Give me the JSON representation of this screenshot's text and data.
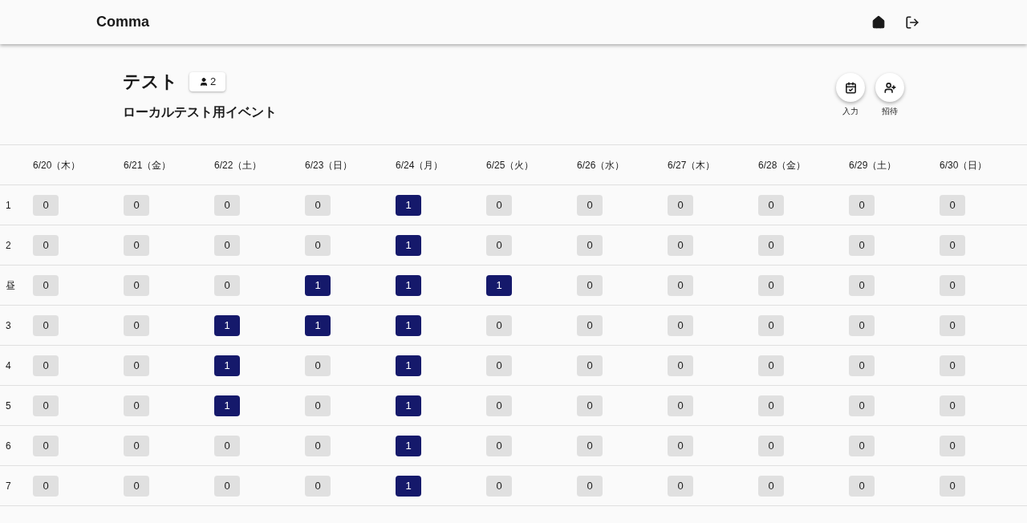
{
  "app_bar": {
    "title": "Comma"
  },
  "event": {
    "title": "テスト",
    "member_count": "2",
    "description": "ローカルテスト用イベント"
  },
  "actions": [
    {
      "kind": "input",
      "label": "入力"
    },
    {
      "kind": "invite",
      "label": "招待"
    }
  ],
  "table": {
    "columns": [
      "6/20（木）",
      "6/21（金）",
      "6/22（土）",
      "6/23（日）",
      "6/24（月）",
      "6/25（火）",
      "6/26（水）",
      "6/27（木）",
      "6/28（金）",
      "6/29（土）",
      "6/30（日）"
    ],
    "rows": [
      {
        "label": "1",
        "cells": [
          {
            "count": "0",
            "highlighted": false
          },
          {
            "count": "0",
            "highlighted": false
          },
          {
            "count": "0",
            "highlighted": false
          },
          {
            "count": "0",
            "highlighted": false
          },
          {
            "count": "1",
            "highlighted": true
          },
          {
            "count": "0",
            "highlighted": false
          },
          {
            "count": "0",
            "highlighted": false
          },
          {
            "count": "0",
            "highlighted": false
          },
          {
            "count": "0",
            "highlighted": false
          },
          {
            "count": "0",
            "highlighted": false
          },
          {
            "count": "0",
            "highlighted": false
          }
        ]
      },
      {
        "label": "2",
        "cells": [
          {
            "count": "0",
            "highlighted": false
          },
          {
            "count": "0",
            "highlighted": false
          },
          {
            "count": "0",
            "highlighted": false
          },
          {
            "count": "0",
            "highlighted": false
          },
          {
            "count": "1",
            "highlighted": true
          },
          {
            "count": "0",
            "highlighted": false
          },
          {
            "count": "0",
            "highlighted": false
          },
          {
            "count": "0",
            "highlighted": false
          },
          {
            "count": "0",
            "highlighted": false
          },
          {
            "count": "0",
            "highlighted": false
          },
          {
            "count": "0",
            "highlighted": false
          }
        ]
      },
      {
        "label": "昼",
        "cells": [
          {
            "count": "0",
            "highlighted": false
          },
          {
            "count": "0",
            "highlighted": false
          },
          {
            "count": "0",
            "highlighted": false
          },
          {
            "count": "1",
            "highlighted": true
          },
          {
            "count": "1",
            "highlighted": true
          },
          {
            "count": "1",
            "highlighted": true
          },
          {
            "count": "0",
            "highlighted": false
          },
          {
            "count": "0",
            "highlighted": false
          },
          {
            "count": "0",
            "highlighted": false
          },
          {
            "count": "0",
            "highlighted": false
          },
          {
            "count": "0",
            "highlighted": false
          }
        ]
      },
      {
        "label": "3",
        "cells": [
          {
            "count": "0",
            "highlighted": false
          },
          {
            "count": "0",
            "highlighted": false
          },
          {
            "count": "1",
            "highlighted": true
          },
          {
            "count": "1",
            "highlighted": true
          },
          {
            "count": "1",
            "highlighted": true
          },
          {
            "count": "0",
            "highlighted": false
          },
          {
            "count": "0",
            "highlighted": false
          },
          {
            "count": "0",
            "highlighted": false
          },
          {
            "count": "0",
            "highlighted": false
          },
          {
            "count": "0",
            "highlighted": false
          },
          {
            "count": "0",
            "highlighted": false
          }
        ]
      },
      {
        "label": "4",
        "cells": [
          {
            "count": "0",
            "highlighted": false
          },
          {
            "count": "0",
            "highlighted": false
          },
          {
            "count": "1",
            "highlighted": true
          },
          {
            "count": "0",
            "highlighted": false
          },
          {
            "count": "1",
            "highlighted": true
          },
          {
            "count": "0",
            "highlighted": false
          },
          {
            "count": "0",
            "highlighted": false
          },
          {
            "count": "0",
            "highlighted": false
          },
          {
            "count": "0",
            "highlighted": false
          },
          {
            "count": "0",
            "highlighted": false
          },
          {
            "count": "0",
            "highlighted": false
          }
        ]
      },
      {
        "label": "5",
        "cells": [
          {
            "count": "0",
            "highlighted": false
          },
          {
            "count": "0",
            "highlighted": false
          },
          {
            "count": "1",
            "highlighted": true
          },
          {
            "count": "0",
            "highlighted": false
          },
          {
            "count": "1",
            "highlighted": true
          },
          {
            "count": "0",
            "highlighted": false
          },
          {
            "count": "0",
            "highlighted": false
          },
          {
            "count": "0",
            "highlighted": false
          },
          {
            "count": "0",
            "highlighted": false
          },
          {
            "count": "0",
            "highlighted": false
          },
          {
            "count": "0",
            "highlighted": false
          }
        ]
      },
      {
        "label": "6",
        "cells": [
          {
            "count": "0",
            "highlighted": false
          },
          {
            "count": "0",
            "highlighted": false
          },
          {
            "count": "0",
            "highlighted": false
          },
          {
            "count": "0",
            "highlighted": false
          },
          {
            "count": "1",
            "highlighted": true
          },
          {
            "count": "0",
            "highlighted": false
          },
          {
            "count": "0",
            "highlighted": false
          },
          {
            "count": "0",
            "highlighted": false
          },
          {
            "count": "0",
            "highlighted": false
          },
          {
            "count": "0",
            "highlighted": false
          },
          {
            "count": "0",
            "highlighted": false
          }
        ]
      },
      {
        "label": "7",
        "cells": [
          {
            "count": "0",
            "highlighted": false
          },
          {
            "count": "0",
            "highlighted": false
          },
          {
            "count": "0",
            "highlighted": false
          },
          {
            "count": "0",
            "highlighted": false
          },
          {
            "count": "1",
            "highlighted": true
          },
          {
            "count": "0",
            "highlighted": false
          },
          {
            "count": "0",
            "highlighted": false
          },
          {
            "count": "0",
            "highlighted": false
          },
          {
            "count": "0",
            "highlighted": false
          },
          {
            "count": "0",
            "highlighted": false
          },
          {
            "count": "0",
            "highlighted": false
          }
        ]
      }
    ]
  }
}
